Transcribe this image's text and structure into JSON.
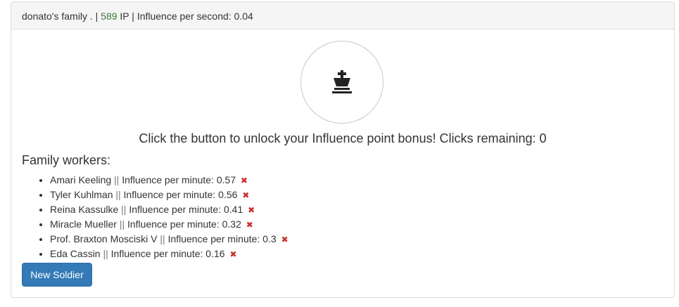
{
  "header": {
    "family_name": "donato's family .",
    "sep1": "|",
    "ip_value": "589",
    "ip_unit": "IP",
    "sep2": "|",
    "influence_per_second": "Influence per second: 0.04"
  },
  "bonus": {
    "icon": "chess-king-icon",
    "text": "Click the button to unlock your Influence point bonus! Clicks remaining: 0"
  },
  "workers": {
    "title": "Family workers:",
    "separator": "||",
    "remove_icon": "close-icon",
    "remove_color": "#c9302c",
    "items": [
      {
        "name": "Amari Keeling",
        "rate": "Influence per minute: 0.57"
      },
      {
        "name": "Tyler Kuhlman",
        "rate": "Influence per minute: 0.56"
      },
      {
        "name": "Reina Kassulke",
        "rate": "Influence per minute: 0.41"
      },
      {
        "name": "Miracle Mueller",
        "rate": "Influence per minute: 0.32"
      },
      {
        "name": "Prof. Braxton Mosciski V",
        "rate": "Influence per minute: 0.3"
      },
      {
        "name": "Eda Cassin",
        "rate": "Influence per minute: 0.16"
      }
    ]
  },
  "actions": {
    "new_soldier_label": "New Soldier",
    "button_color": "#337ab7"
  }
}
